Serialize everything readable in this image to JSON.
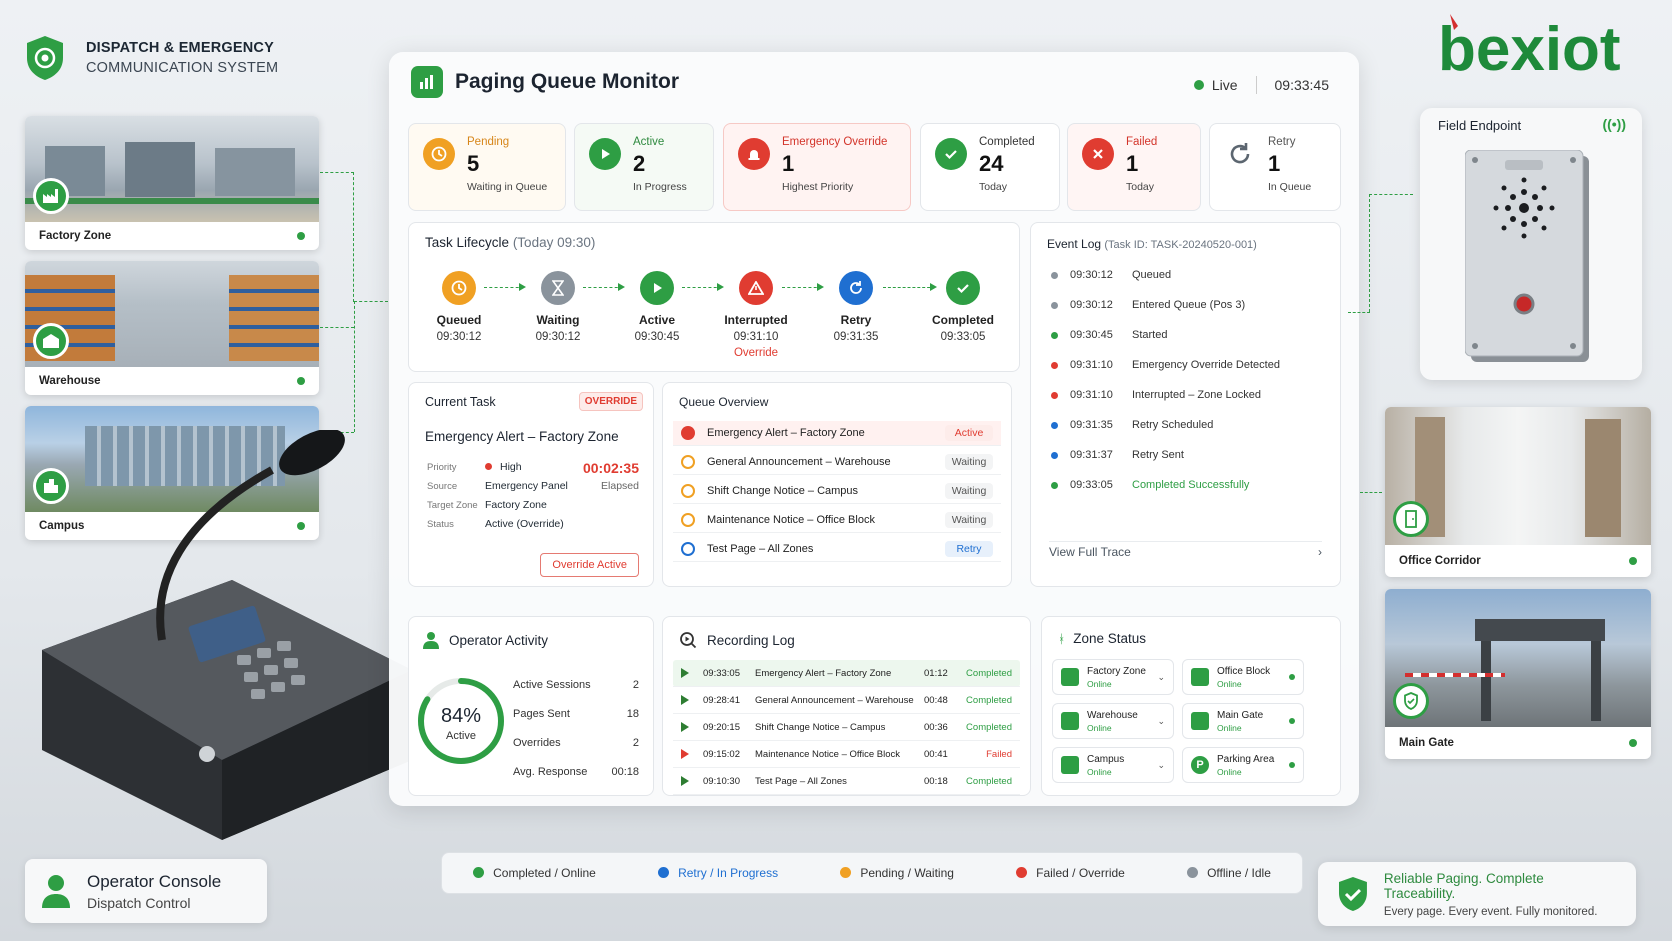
{
  "brand": {
    "line1": "DISPATCH & EMERGENCY",
    "line2": "COMMUNICATION SYSTEM"
  },
  "logo": {
    "text": "bexiot",
    "color": "#1e8a3a",
    "accent": "#d32f2f"
  },
  "colors": {
    "green": "#2e9e44",
    "blue": "#1f6fd1",
    "orange": "#f0a023",
    "red": "#e03c31",
    "gray": "#8a939c"
  },
  "left_zones": [
    {
      "label": "Factory Zone",
      "icon": "factory-icon"
    },
    {
      "label": "Warehouse",
      "icon": "warehouse-icon"
    },
    {
      "label": "Campus",
      "icon": "campus-icon"
    }
  ],
  "console": {
    "title": "Operator Console",
    "subtitle": "Dispatch Control"
  },
  "panel": {
    "title": "Paging Queue Monitor",
    "live_label": "Live",
    "time": "09:33:45"
  },
  "stats": [
    {
      "label": "Pending",
      "value": "5",
      "sub": "Waiting in Queue",
      "icon": "clock-icon"
    },
    {
      "label": "Active",
      "value": "2",
      "sub": "In Progress",
      "icon": "play-icon"
    },
    {
      "label": "Emergency Override",
      "value": "1",
      "sub": "Highest Priority",
      "icon": "alarm-icon"
    },
    {
      "label": "Completed",
      "value": "24",
      "sub": "Today",
      "icon": "check-icon"
    },
    {
      "label": "Failed",
      "value": "1",
      "sub": "Today",
      "icon": "x-icon"
    },
    {
      "label": "Retry",
      "value": "1",
      "sub": "In Queue",
      "icon": "refresh-icon"
    }
  ],
  "lifecycle": {
    "title": "Task Lifecycle",
    "subtitle": "(Today 09:30)",
    "steps": [
      {
        "name": "Queued",
        "time": "09:30:12"
      },
      {
        "name": "Waiting",
        "time": "09:30:12"
      },
      {
        "name": "Active",
        "time": "09:30:45"
      },
      {
        "name": "Interrupted",
        "time": "09:31:10",
        "note": "Override"
      },
      {
        "name": "Retry",
        "time": "09:31:35"
      },
      {
        "name": "Completed",
        "time": "09:33:05"
      }
    ]
  },
  "event_log": {
    "title": "Event Log",
    "task_id": "(Task ID: TASK-20240520-001)",
    "events": [
      {
        "time": "09:30:12",
        "text": "Queued",
        "color": "#8a939c"
      },
      {
        "time": "09:30:12",
        "text": "Entered Queue (Pos 3)",
        "color": "#8a939c"
      },
      {
        "time": "09:30:45",
        "text": "Started",
        "color": "#2e9e44"
      },
      {
        "time": "09:31:10",
        "text": "Emergency Override Detected",
        "color": "#e03c31"
      },
      {
        "time": "09:31:10",
        "text": "Interrupted – Zone Locked",
        "color": "#e03c31"
      },
      {
        "time": "09:31:35",
        "text": "Retry Scheduled",
        "color": "#1f6fd1"
      },
      {
        "time": "09:31:37",
        "text": "Retry Sent",
        "color": "#1f6fd1"
      },
      {
        "time": "09:33:05",
        "text": "Completed Successfully",
        "color": "#2e9e44"
      }
    ],
    "view_trace": "View Full Trace"
  },
  "current_task": {
    "title": "Current Task",
    "badge": "OVERRIDE",
    "name": "Emergency Alert – Factory Zone",
    "elapsed": "00:02:35",
    "elapsed_label": "Elapsed",
    "fields": [
      {
        "key": "Priority",
        "value": "High"
      },
      {
        "key": "Source",
        "value": "Emergency Panel"
      },
      {
        "key": "Target Zone",
        "value": "Factory Zone"
      },
      {
        "key": "Status",
        "value": "Active (Override)"
      }
    ],
    "button": "Override Active"
  },
  "queue": {
    "title": "Queue Overview",
    "items": [
      {
        "name": "Emergency Alert – Factory Zone",
        "status": "Active",
        "kind": "red"
      },
      {
        "name": "General Announcement – Warehouse",
        "status": "Waiting",
        "kind": "orange"
      },
      {
        "name": "Shift Change Notice – Campus",
        "status": "Waiting",
        "kind": "orange"
      },
      {
        "name": "Maintenance Notice – Office Block",
        "status": "Waiting",
        "kind": "orange"
      },
      {
        "name": "Test Page – All Zones",
        "status": "Retry",
        "kind": "blue"
      }
    ]
  },
  "operator": {
    "title": "Operator Activity",
    "percent": 84,
    "percent_label": "84%",
    "active_label": "Active",
    "rows": [
      {
        "label": "Active Sessions",
        "value": "2"
      },
      {
        "label": "Pages Sent",
        "value": "18"
      },
      {
        "label": "Overrides",
        "value": "2"
      },
      {
        "label": "Avg. Response",
        "value": "00:18"
      }
    ]
  },
  "recording": {
    "title": "Recording Log",
    "rows": [
      {
        "time": "09:33:05",
        "name": "Emergency Alert – Factory Zone",
        "dur": "01:12",
        "status": "Completed"
      },
      {
        "time": "09:28:41",
        "name": "General Announcement – Warehouse",
        "dur": "00:48",
        "status": "Completed"
      },
      {
        "time": "09:20:15",
        "name": "Shift Change Notice – Campus",
        "dur": "00:36",
        "status": "Completed"
      },
      {
        "time": "09:15:02",
        "name": "Maintenance Notice – Office Block",
        "dur": "00:41",
        "status": "Failed"
      },
      {
        "time": "09:10:30",
        "name": "Test Page – All Zones",
        "dur": "00:18",
        "status": "Completed"
      }
    ]
  },
  "zone_status": {
    "title": "Zone Status",
    "zones": [
      {
        "name": "Factory Zone",
        "state": "Online"
      },
      {
        "name": "Office Block",
        "state": "Online"
      },
      {
        "name": "Warehouse",
        "state": "Online"
      },
      {
        "name": "Main Gate",
        "state": "Online"
      },
      {
        "name": "Campus",
        "state": "Online"
      },
      {
        "name": "Parking Area",
        "state": "Online"
      }
    ]
  },
  "legend": [
    {
      "label": "Completed / Online",
      "color": "#2e9e44"
    },
    {
      "label": "Retry / In Progress",
      "color": "#1f6fd1"
    },
    {
      "label": "Pending / Waiting",
      "color": "#f0a023"
    },
    {
      "label": "Failed / Override",
      "color": "#e03c31"
    },
    {
      "label": "Offline / Idle",
      "color": "#8a939c"
    }
  ],
  "field_endpoint": {
    "title": "Field Endpoint"
  },
  "right_zones": [
    {
      "label": "Office Corridor",
      "icon": "door-icon"
    },
    {
      "label": "Main Gate",
      "icon": "shield-icon"
    }
  ],
  "tagline": {
    "line1": "Reliable Paging. Complete Traceability.",
    "line2": "Every page. Every event. Fully monitored."
  }
}
